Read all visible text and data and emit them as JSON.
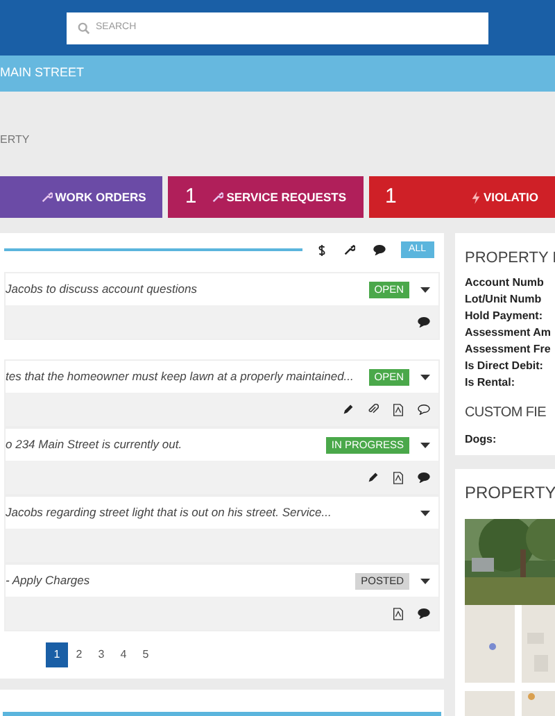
{
  "header": {
    "search": {
      "placeholder": "SEARCH"
    }
  },
  "breadcrumb": "MAIN STREET",
  "page_title": "ERTY",
  "tiles": [
    {
      "kind": "work_orders",
      "label": "WORK ORDERS",
      "color": "#6b4ba6"
    },
    {
      "kind": "service_requests",
      "count": "1",
      "label": "SERVICE REQUESTS",
      "color": "#b01f5a"
    },
    {
      "kind": "violations",
      "count": "1",
      "label": "VIOLATIO",
      "color": "#cf2027"
    }
  ],
  "filters": [
    {
      "kind": "charges",
      "selected": false
    },
    {
      "kind": "work_order",
      "selected": false
    },
    {
      "kind": "comment",
      "selected": false
    },
    {
      "kind": "all",
      "label": "ALL",
      "selected": true
    }
  ],
  "items": [
    {
      "text": "Jacobs to discuss account questions",
      "status": {
        "label": "OPEN",
        "color": "#4aa84a"
      },
      "actions": [
        {
          "kind": "comment"
        }
      ]
    },
    {
      "text": "tes that the homeowner must keep lawn at a properly maintained...",
      "status": {
        "label": "OPEN",
        "color": "#4aa84a"
      },
      "actions": [
        {
          "kind": "edit"
        },
        {
          "kind": "attach"
        },
        {
          "kind": "pdf"
        },
        {
          "kind": "comment_empty"
        }
      ]
    },
    {
      "text": "o 234 Main Street is currently out.",
      "status": {
        "label": "IN PROGRESS",
        "color": "#4aa84a"
      },
      "actions": [
        {
          "kind": "edit"
        },
        {
          "kind": "pdf"
        },
        {
          "kind": "comment"
        }
      ]
    },
    {
      "text": "Jacobs regarding street light that is out on his street. Service..."
    },
    {
      "text": "- Apply Charges",
      "status": {
        "label": "POSTED",
        "color": "#d4d4d4"
      },
      "actions": [
        {
          "kind": "pdf"
        },
        {
          "kind": "comment"
        }
      ]
    }
  ],
  "pagination": [
    {
      "label": "1",
      "selected": true
    },
    {
      "label": "2",
      "selected": false
    },
    {
      "label": "3",
      "selected": false
    },
    {
      "label": "4",
      "selected": false
    },
    {
      "label": "5",
      "selected": false
    }
  ],
  "property_info": {
    "title": "PROPERTY I",
    "fields": [
      "Account Numb",
      "Lot/Unit Numb",
      "Hold Payment:",
      "Assessment Am",
      "Assessment Fre",
      "Is Direct Debit:",
      "Is Rental:"
    ]
  },
  "custom_fields": {
    "title": "CUSTOM FIE",
    "fields": [
      "Dogs:"
    ]
  },
  "property_media": {
    "title": "PROPERTY"
  }
}
